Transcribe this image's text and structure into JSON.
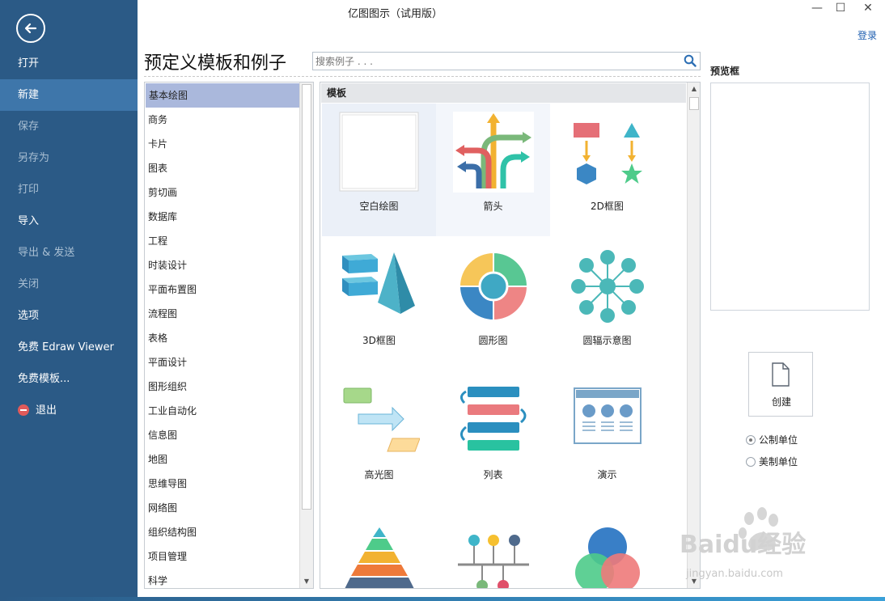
{
  "window": {
    "title": "亿图图示（试用版）",
    "login": "登录",
    "minimize": "—",
    "maximize": "☐",
    "close": "✕"
  },
  "sidebar": {
    "items": [
      {
        "label": "打开"
      },
      {
        "label": "新建"
      },
      {
        "label": "保存"
      },
      {
        "label": "另存为"
      },
      {
        "label": "打印"
      },
      {
        "label": "导入"
      },
      {
        "label": "导出 & 发送"
      },
      {
        "label": "关闭"
      },
      {
        "label": "选项"
      },
      {
        "label": "免费 Edraw Viewer"
      },
      {
        "label": "免费模板..."
      },
      {
        "label": "退出"
      }
    ],
    "active": "新建"
  },
  "main": {
    "heading": "预定义模板和例子",
    "search_placeholder": "搜索例子 . . .",
    "categories": [
      "基本绘图",
      "商务",
      "卡片",
      "图表",
      "剪切画",
      "数据库",
      "工程",
      "时装设计",
      "平面布置图",
      "流程图",
      "表格",
      "平面设计",
      "图形组织",
      "工业自动化",
      "信息图",
      "地图",
      "思维导图",
      "网络图",
      "组织结构图",
      "项目管理",
      "科学"
    ],
    "selected_category": "基本绘图",
    "templates_header": "模板",
    "templates": [
      "空白绘图",
      "箭头",
      "2D框图",
      "3D框图",
      "圆形图",
      "圆辐示意图",
      "高光图",
      "列表",
      "演示"
    ]
  },
  "preview": {
    "label": "预览框"
  },
  "create": {
    "label": "创建"
  },
  "units": {
    "metric": "公制单位",
    "us": "美制单位",
    "selected": "metric"
  },
  "watermark": {
    "text": "Baidu经验",
    "url": "jingyan.baidu.com"
  },
  "colors": {
    "sidebar": "#2b5a86",
    "sidebar_active": "#3e76aa",
    "category_selected": "#aab8dc",
    "link": "#1f5fb0"
  }
}
